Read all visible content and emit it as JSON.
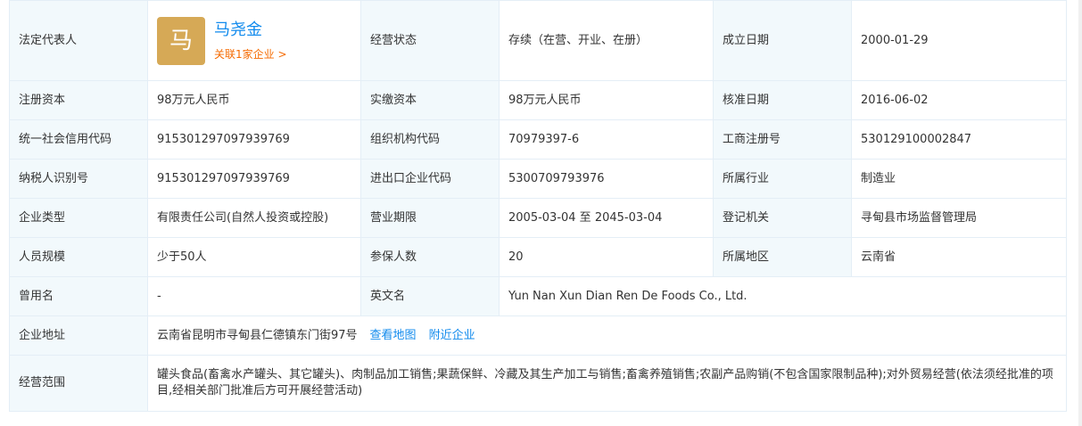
{
  "legal_rep": {
    "label": "法定代表人",
    "avatar_char": "马",
    "name": "马尧金",
    "link": "关联1家企业 >"
  },
  "status": {
    "label": "经营状态",
    "value": "存续（在营、开业、在册）"
  },
  "founded": {
    "label": "成立日期",
    "value": "2000-01-29"
  },
  "reg_capital": {
    "label": "注册资本",
    "value": "98万元人民币"
  },
  "paid_capital": {
    "label": "实缴资本",
    "value": "98万元人民币"
  },
  "approved": {
    "label": "核准日期",
    "value": "2016-06-02"
  },
  "credit_code": {
    "label": "统一社会信用代码",
    "value": "915301297097939769"
  },
  "org_code": {
    "label": "组织机构代码",
    "value": "70979397-6"
  },
  "reg_no": {
    "label": "工商注册号",
    "value": "530129100002847"
  },
  "taxpayer_id": {
    "label": "纳税人识别号",
    "value": "915301297097939769"
  },
  "import_export": {
    "label": "进出口企业代码",
    "value": "5300709793976"
  },
  "industry": {
    "label": "所属行业",
    "value": "制造业"
  },
  "company_type": {
    "label": "企业类型",
    "value": "有限责任公司(自然人投资或控股)"
  },
  "term": {
    "label": "营业期限",
    "value": "2005-03-04 至 2045-03-04"
  },
  "authority": {
    "label": "登记机关",
    "value": "寻甸县市场监督管理局"
  },
  "staff": {
    "label": "人员规模",
    "value": "少于50人"
  },
  "insured": {
    "label": "参保人数",
    "value": "20"
  },
  "region": {
    "label": "所属地区",
    "value": "云南省"
  },
  "former_name": {
    "label": "曾用名",
    "value": "-"
  },
  "english_name": {
    "label": "英文名",
    "value": "Yun Nan Xun Dian Ren De Foods Co., Ltd."
  },
  "address": {
    "label": "企业地址",
    "value": "云南省昆明市寻甸县仁德镇东门街97号",
    "map_link": "查看地图",
    "nearby_link": "附近企业"
  },
  "scope": {
    "label": "经营范围",
    "value": "罐头食品(畜禽水产罐头、其它罐头)、肉制品加工销售;果蔬保鲜、冷藏及其生产加工与销售;畜禽养殖销售;农副产品购销(不包含国家限制品种);对外贸易经营(依法须经批准的项目,经相关部门批准后方可开展经营活动)"
  }
}
